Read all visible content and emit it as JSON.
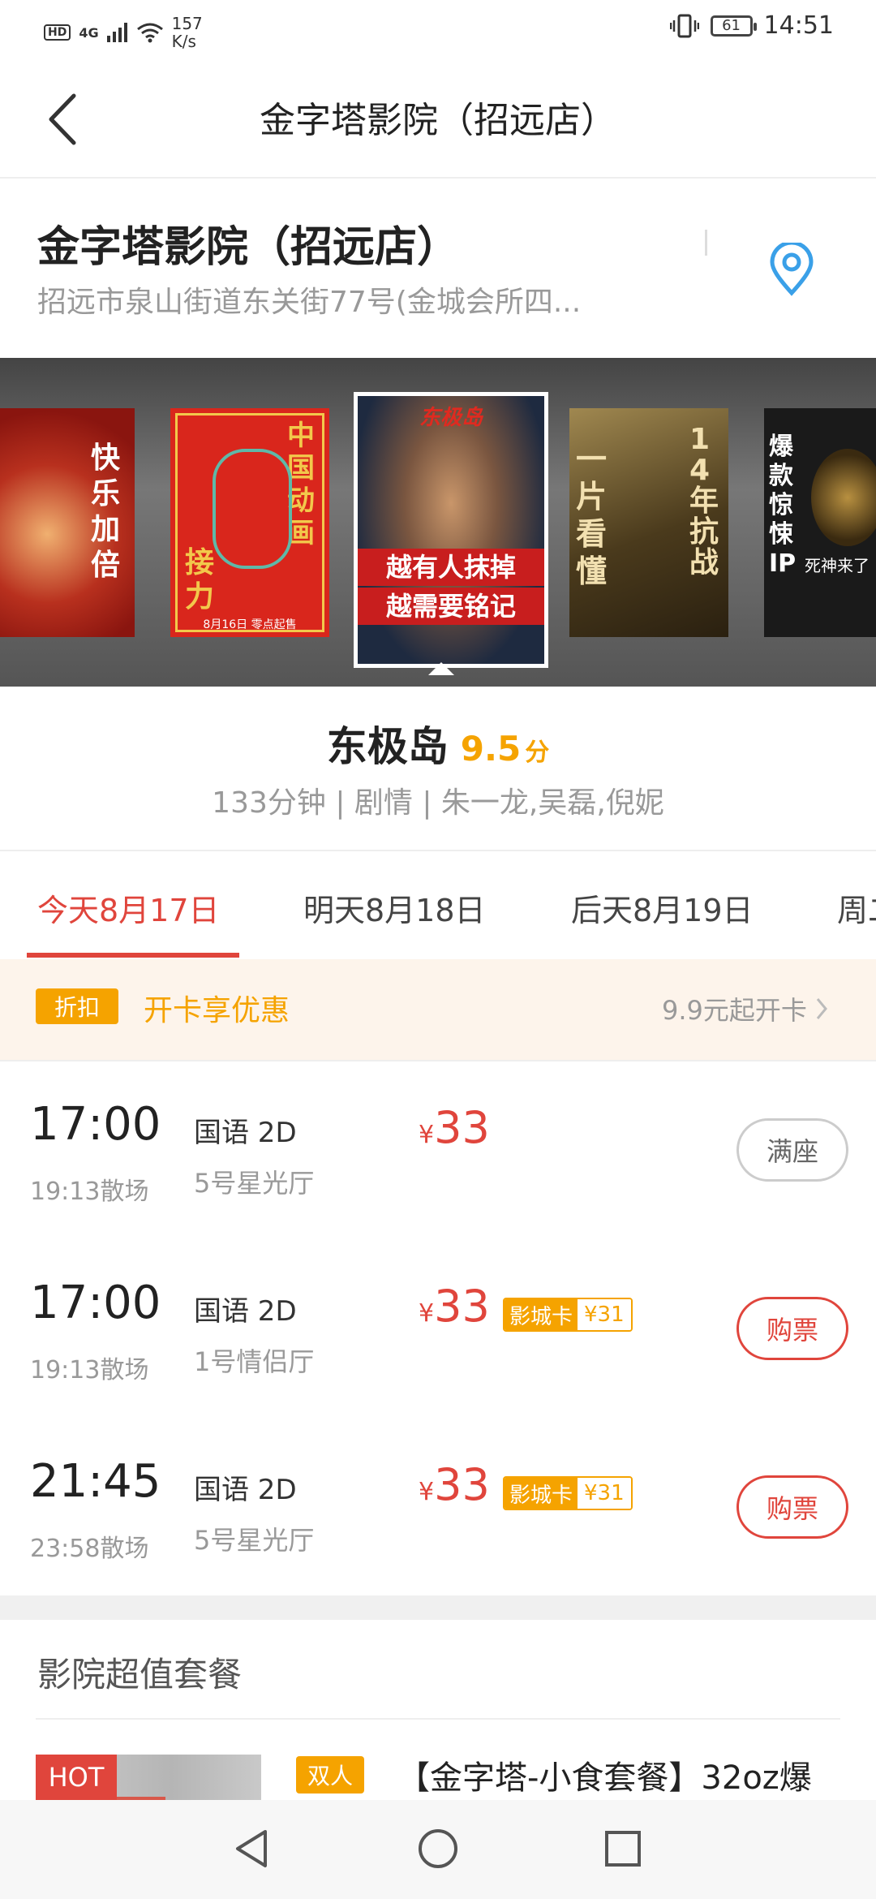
{
  "status_bar": {
    "network": "4G",
    "hd": "HD",
    "speed_value": "157",
    "speed_unit": "K/s",
    "battery": "61",
    "time": "14:51"
  },
  "nav": {
    "title": "金字塔影院（招远店）"
  },
  "cinema": {
    "name": "金字塔影院（招远店）",
    "address": "招远市泉山街道东关街77号(金城会所四..."
  },
  "posters": [
    {
      "text": "快乐加倍",
      "color": "#c8201a"
    },
    {
      "text_a": "中国动画",
      "text_b": "接力",
      "date": "8月16日 零点起售",
      "color": "#d9261c"
    },
    {
      "banner": "东极岛",
      "line1": "越有人抹掉",
      "line2": "越需要铭记",
      "color": "#2a3a55"
    },
    {
      "left": "一片看懂",
      "right": "14年抗战",
      "color": "#6b5a2c"
    },
    {
      "text": "爆款惊悚IP",
      "sub": "死神来了",
      "color": "#1a1a1a"
    }
  ],
  "movie": {
    "title": "东极岛",
    "score": "9.5",
    "score_unit": "分",
    "meta": "133分钟 | 剧情 | 朱一龙,吴磊,倪妮"
  },
  "tabs": [
    {
      "label": "今天8月17日"
    },
    {
      "label": "明天8月18日"
    },
    {
      "label": "后天8月19日"
    },
    {
      "label": "周二"
    }
  ],
  "promo": {
    "badge": "折扣",
    "text": "开卡享优惠",
    "right": "9.9元起开卡"
  },
  "showtimes": [
    {
      "start": "17:00",
      "end": "19:13散场",
      "lang": "国语 2D",
      "hall": "5号星光厅",
      "yen": "¥",
      "price": "33",
      "card_label": "",
      "card_price": "",
      "button": "满座"
    },
    {
      "start": "17:00",
      "end": "19:13散场",
      "lang": "国语 2D",
      "hall": "1号情侣厅",
      "yen": "¥",
      "price": "33",
      "card_label": "影城卡",
      "card_price": "¥31",
      "button": "购票"
    },
    {
      "start": "21:45",
      "end": "23:58散场",
      "lang": "国语 2D",
      "hall": "5号星光厅",
      "yen": "¥",
      "price": "33",
      "card_label": "影城卡",
      "card_price": "¥31",
      "button": "购票"
    }
  ],
  "combo": {
    "section_title": "影院超值套餐",
    "hot": "HOT",
    "tag": "双人",
    "name": "【金字塔-小食套餐】32oz爆"
  },
  "colors": {
    "accent": "#e0453c",
    "gold": "#f5a300"
  }
}
